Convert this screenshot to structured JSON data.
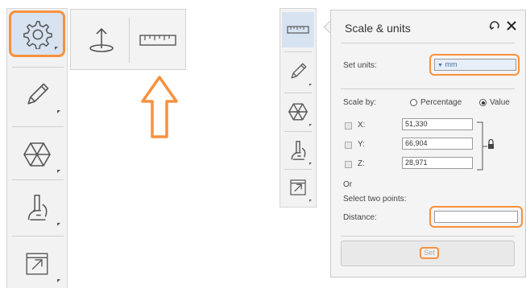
{
  "toolbar_left": {
    "items": [
      {
        "icon": "gear-icon",
        "active": true
      },
      {
        "icon": "pencil-icon"
      },
      {
        "icon": "hexagon-mesh-icon"
      },
      {
        "icon": "microscope-icon"
      },
      {
        "icon": "export-icon"
      }
    ]
  },
  "popout": {
    "items": [
      {
        "icon": "pin-plane-icon"
      },
      {
        "icon": "ruler-icon"
      }
    ]
  },
  "toolbar_right": {
    "items": [
      {
        "icon": "ruler-icon",
        "active": true
      },
      {
        "icon": "pencil-icon"
      },
      {
        "icon": "hexagon-mesh-icon"
      },
      {
        "icon": "microscope-icon"
      },
      {
        "icon": "export-icon"
      }
    ]
  },
  "panel": {
    "title": "Scale & units",
    "set_units_label": "Set units:",
    "units_value": "mm",
    "scale_by_label": "Scale by:",
    "option_percentage": "Percentage",
    "option_value": "Value",
    "selected_option": "Value",
    "axes": [
      {
        "label": "X:",
        "value": "51,330"
      },
      {
        "label": "Y:",
        "value": "66,904"
      },
      {
        "label": "Z:",
        "value": "28,971"
      }
    ],
    "or_label": "Or",
    "select_points_label": "Select two points:",
    "distance_label": "Distance:",
    "distance_value": "",
    "set_button_label": "Set"
  },
  "colors": {
    "highlight": "#f7913d",
    "active_bg": "#d8e3f1",
    "panel_bg": "#f4f4f4"
  }
}
